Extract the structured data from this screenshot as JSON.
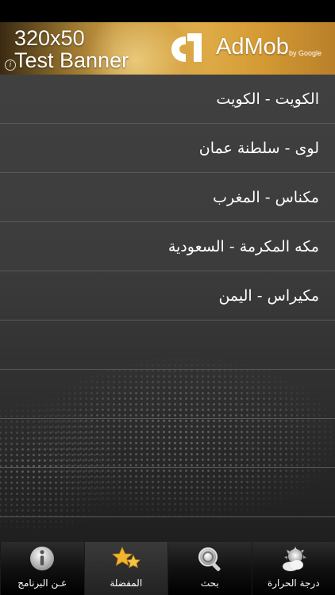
{
  "ad": {
    "test_line1": "320x50",
    "test_line2": "Test Banner",
    "brand": "AdMob",
    "brand_sub": "by Google",
    "info_glyph": "i"
  },
  "cities": [
    {
      "label": "الكويت - الكويت"
    },
    {
      "label": "لوى - سلطنة عمان"
    },
    {
      "label": "مكناس - المغرب"
    },
    {
      "label": "مكه المكرمة - السعودية"
    },
    {
      "label": "مكيراس - اليمن"
    }
  ],
  "tabs": [
    {
      "label": "درجة الحرارة",
      "icon": "weather-icon",
      "selected": false
    },
    {
      "label": "بحث",
      "icon": "search-icon",
      "selected": false
    },
    {
      "label": "المفضلة",
      "icon": "favorites-icon",
      "selected": true
    },
    {
      "label": "عـن البرنامج",
      "icon": "info-icon",
      "selected": false
    }
  ],
  "colors": {
    "list_bg": "#3c3c3c",
    "separator": "#5a5a5a",
    "tab_bar": "#111111",
    "star": "#f2b531"
  }
}
